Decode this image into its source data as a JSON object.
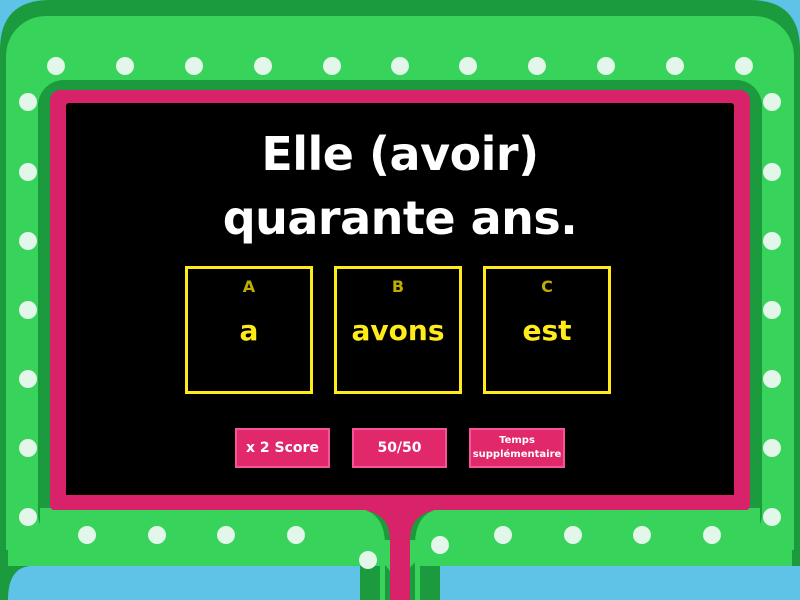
{
  "question": {
    "line1": "Elle (avoir)",
    "line2": "quarante ans."
  },
  "answers": [
    {
      "letter": "A",
      "text": "a"
    },
    {
      "letter": "B",
      "text": "avons"
    },
    {
      "letter": "C",
      "text": "est"
    }
  ],
  "powerups": {
    "double_score": "x 2 Score",
    "fifty_fifty": "50/50",
    "extra_time_line1": "Temps",
    "extra_time_line2": "supplémentaire"
  },
  "colors": {
    "sky": "#5ec3e6",
    "frame_dark": "#1c9a3e",
    "frame_green": "#37d35a",
    "bulb": "#e2f6ea",
    "border_pink": "#d8226a",
    "board": "#000000",
    "answer_yellow": "#ffeb1a",
    "powerup_pink": "#e0286a"
  }
}
